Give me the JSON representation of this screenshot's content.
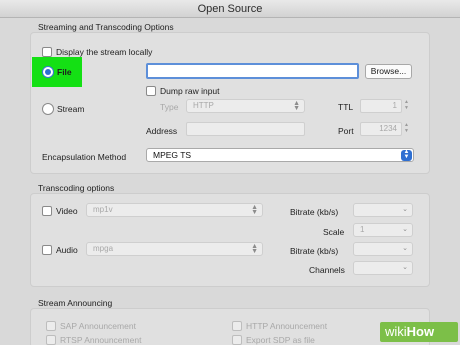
{
  "window": {
    "title": "Open Source"
  },
  "streaming": {
    "section_title": "Streaming and Transcoding Options",
    "display_locally": "Display the stream locally",
    "file_label": "File",
    "browse_label": "Browse...",
    "dump_raw": "Dump raw input",
    "stream_label": "Stream",
    "type_label": "Type",
    "type_value": "HTTP",
    "ttl_label": "TTL",
    "ttl_value": "1",
    "address_label": "Address",
    "port_label": "Port",
    "port_value": "1234",
    "encapsulation_label": "Encapsulation Method",
    "encapsulation_value": "MPEG TS"
  },
  "transcoding": {
    "section_title": "Transcoding options",
    "video_label": "Video",
    "video_codec": "mp1v",
    "bitrate_label": "Bitrate (kb/s)",
    "scale_label": "Scale",
    "scale_value": "1",
    "audio_label": "Audio",
    "audio_codec": "mpga",
    "audio_bitrate_label": "Bitrate (kb/s)",
    "channels_label": "Channels"
  },
  "announcing": {
    "section_title": "Stream Announcing",
    "sap": "SAP Announcement",
    "rtsp": "RTSP Announcement",
    "http": "HTTP Announcement",
    "export_sdp": "Export SDP as file"
  },
  "watermark": {
    "wiki": "wiki",
    "how": "How"
  },
  "colors": {
    "highlight": "#14e014",
    "accent": "#2f6fd1"
  }
}
